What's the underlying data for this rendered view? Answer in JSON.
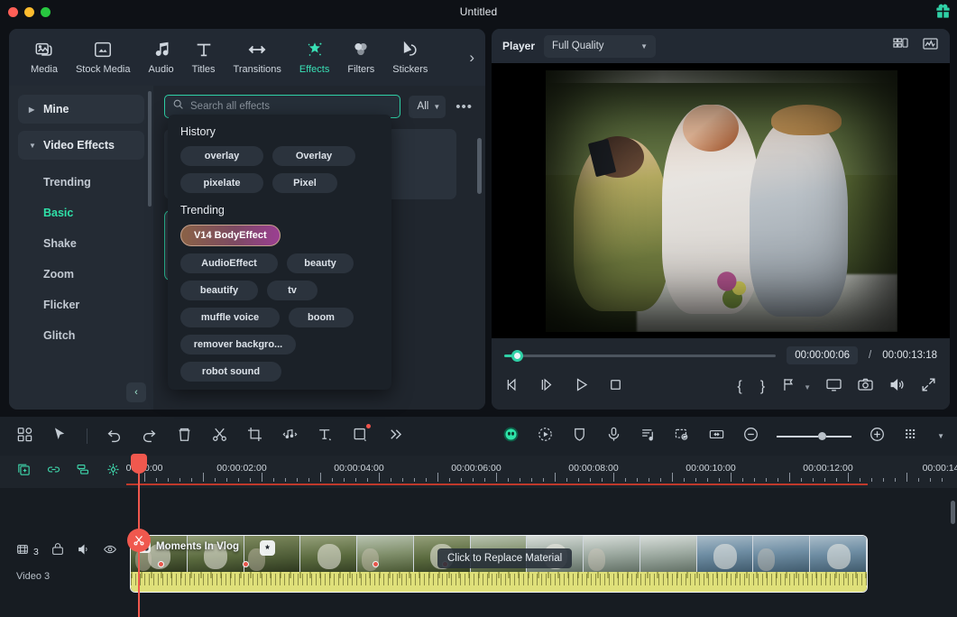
{
  "window": {
    "title": "Untitled",
    "gift_icon": "gift-icon"
  },
  "tabs": [
    {
      "id": "media",
      "label": "Media",
      "icon": "media-icon",
      "active": false
    },
    {
      "id": "stock-media",
      "label": "Stock Media",
      "icon": "stock-media-icon",
      "active": false
    },
    {
      "id": "audio",
      "label": "Audio",
      "icon": "audio-icon",
      "active": false
    },
    {
      "id": "titles",
      "label": "Titles",
      "icon": "titles-icon",
      "active": false
    },
    {
      "id": "transitions",
      "label": "Transitions",
      "icon": "transitions-icon",
      "active": false
    },
    {
      "id": "effects",
      "label": "Effects",
      "icon": "effects-icon",
      "active": true
    },
    {
      "id": "filters",
      "label": "Filters",
      "icon": "filters-icon",
      "active": false
    },
    {
      "id": "stickers",
      "label": "Stickers",
      "icon": "stickers-icon",
      "active": false
    }
  ],
  "tab_overflow_label": "›",
  "sidebar": {
    "groups": [
      {
        "label": "Mine",
        "expanded": false
      },
      {
        "label": "Video Effects",
        "expanded": true
      }
    ],
    "items": [
      {
        "label": "Trending",
        "active": false
      },
      {
        "label": "Basic",
        "active": true
      },
      {
        "label": "Shake",
        "active": false
      },
      {
        "label": "Zoom",
        "active": false
      },
      {
        "label": "Flicker",
        "active": false
      },
      {
        "label": "Glitch",
        "active": false
      }
    ],
    "collapse_label": "‹"
  },
  "search": {
    "placeholder": "Search all effects",
    "value": "",
    "icon": "search-icon",
    "filter_label": "All",
    "more_label": "•••"
  },
  "dropdown": {
    "history_heading": "History",
    "history_chips": [
      "overlay",
      "Overlay",
      "pixelate",
      "Pixel"
    ],
    "trending_heading": "Trending",
    "featured_chip": "V14 BodyEffect",
    "trending_chips": [
      "AudioEffect",
      "beauty",
      "beautify",
      "tv",
      "muffle voice",
      "boom",
      "remover backgro...",
      "robot sound"
    ]
  },
  "player": {
    "label": "Player",
    "quality": "Full Quality",
    "header_icons": [
      "split-view-icon",
      "scope-icon"
    ],
    "current_time": "00:00:00:06",
    "time_separator": "/",
    "total_time": "00:00:13:18",
    "controls": {
      "prev_frame": "previous-frame-icon",
      "next_frame": "next-frame-icon",
      "play": "play-icon",
      "stop": "stop-icon",
      "mark_in": "{",
      "mark_out": "}",
      "markers": "markers-icon",
      "fullscreen_display": "display-icon",
      "snapshot": "snapshot-icon",
      "volume": "volume-icon",
      "expand": "expand-icon"
    }
  },
  "timeline": {
    "toolbar_left": [
      "grid-view-icon",
      "select-tool-icon",
      "undo-icon",
      "redo-icon",
      "delete-icon",
      "split-icon",
      "crop-icon",
      "audio-detach-icon",
      "text-icon",
      "mask-icon",
      "more-tools-icon"
    ],
    "toolbar_right": [
      "ai-tools-icon",
      "motion-tracking-icon",
      "stabilization-icon",
      "voiceover-icon",
      "audio-mixer-icon",
      "green-screen-icon",
      "fit-timeline-icon",
      "zoom-out-icon",
      "zoom-in-icon",
      "marker-grid-icon"
    ],
    "track_tools": [
      "add-track-icon",
      "link-icon",
      "group-icon",
      "keyframe-icon"
    ],
    "ruler_labels": [
      "00:00:00",
      "00:00:02:00",
      "00:00:04:00",
      "00:00:06:00",
      "00:00:08:00",
      "00:00:10:00",
      "00:00:12:00",
      "00:00:14"
    ],
    "track": {
      "count": "3",
      "name": "Video 3",
      "icons": [
        "track-type-icon",
        "lock-icon",
        "mute-icon",
        "hide-icon"
      ]
    },
    "clip": {
      "title": "Moments In Vlog",
      "title_icon": "clip-thumb-icon",
      "fx_icon": "effect-applied-icon",
      "replace_tooltip": "Click to Replace Material"
    }
  }
}
